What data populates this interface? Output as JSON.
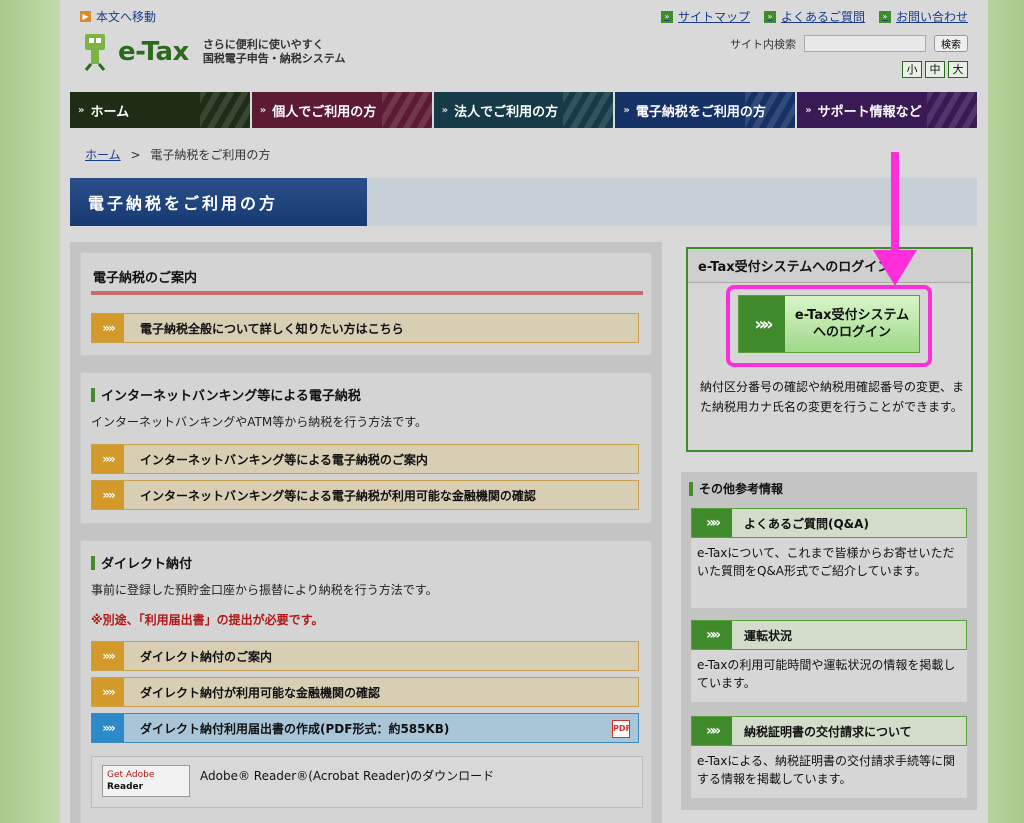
{
  "skip_link": "本文へ移動",
  "top_links": [
    "サイトマップ",
    "よくあるご質問",
    "お問い合わせ"
  ],
  "logo": {
    "brand": "e-Tax",
    "tagline_1": "さらに便利に使いやすく",
    "tagline_2": "国税電子申告・納税システム"
  },
  "search": {
    "label": "サイト内検索",
    "button": "検索"
  },
  "font_size": [
    "小",
    "中",
    "大"
  ],
  "nav": [
    {
      "label": "ホーム",
      "color": "#1f2d17"
    },
    {
      "label": "個人でご利用の方",
      "color": "#5c1a33"
    },
    {
      "label": "法人でご利用の方",
      "color": "#163a47"
    },
    {
      "label": "電子納税をご利用の方",
      "color": "#163166"
    },
    {
      "label": "サポート情報など",
      "color": "#3a1a55"
    }
  ],
  "breadcrumb": {
    "home": "ホーム",
    "sep": ">",
    "current": "電子納税をご利用の方"
  },
  "page_title": "電子納税をご利用の方",
  "guide": {
    "title": "電子納税のご案内",
    "link": "電子納税全般について詳しく知りたい方はこちら"
  },
  "internet_banking": {
    "title": "インターネットバンキング等による電子納税",
    "desc": "インターネットバンキングやATM等から納税を行う方法です。",
    "links": [
      "インターネットバンキング等による電子納税のご案内",
      "インターネットバンキング等による電子納税が利用可能な金融機関の確認"
    ]
  },
  "direct": {
    "title": "ダイレクト納付",
    "desc": "事前に登録した預貯金口座から振替により納税を行う方法です。",
    "note": "※別途、「利用届出書」の提出が必要です。",
    "links": [
      "ダイレクト納付のご案内",
      "ダイレクト納付が利用可能な金融機関の確認"
    ],
    "pdf_link": "ダイレクト納付利用届出書の作成(PDF形式：約585KB)"
  },
  "adobe": {
    "logo_top": "Get Adobe",
    "logo_bottom": "Reader",
    "text": "Adobe® Reader®(Acrobat Reader)のダウンロード"
  },
  "login": {
    "header": "e-Tax受付システムへのログイン",
    "button_line1": "e-Tax受付システム",
    "button_line2": "へのログイン",
    "desc": "納付区分番号の確認や納税用確認番号の変更、また納税用カナ氏名の変更を行うことができます。"
  },
  "other": {
    "title": "その他参考情報",
    "cards": [
      {
        "label": "よくあるご質問(Q&A)",
        "desc": "e-Taxについて、これまで皆様からお寄せいただいた質問をQ&A形式でご紹介しています。"
      },
      {
        "label": "運転状況",
        "desc": "e-Taxの利用可能時間や運転状況の情報を掲載しています。"
      },
      {
        "label": "納税証明書の交付請求について",
        "desc": "e-Taxによる、納税証明書の交付請求手続等に関する情報を掲載しています。"
      }
    ]
  },
  "highlight_color": "#ff2ed8"
}
